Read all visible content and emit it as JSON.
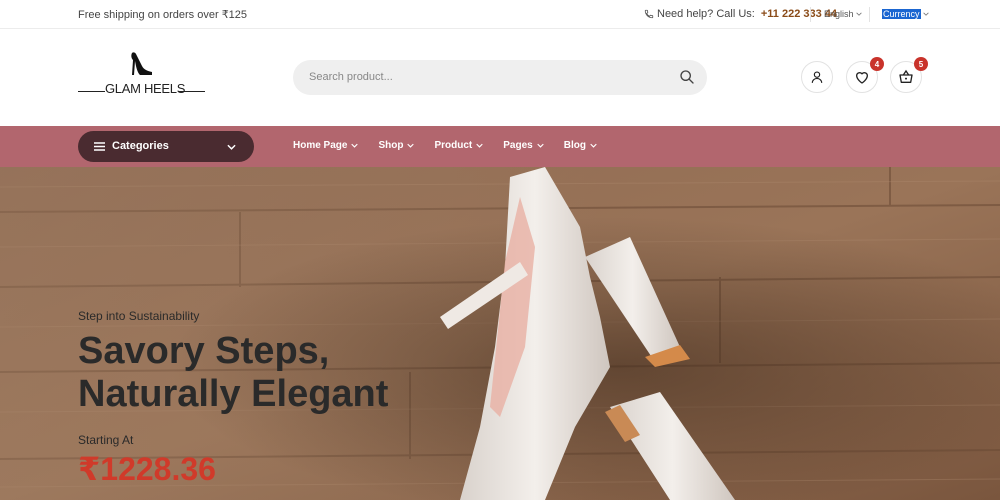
{
  "topbar": {
    "shipping_text": "Free shipping on orders over ₹125",
    "help_text": "Need help? Call Us:",
    "phone": "+11 222 333 44",
    "language": "English",
    "currency": "Currency",
    "phone_icon": "phone-icon",
    "currency_highlight_color": "#1b66d1"
  },
  "header": {
    "logo_text": "GLAM HEELS",
    "search": {
      "placeholder": "Search product..."
    },
    "wishlist_count": "4",
    "cart_count": "5",
    "badge_color": "#c9332b"
  },
  "nav": {
    "categories_label": "Categories",
    "links": [
      {
        "label": "Home Page"
      },
      {
        "label": "Shop"
      },
      {
        "label": "Product"
      },
      {
        "label": "Pages"
      },
      {
        "label": "Blog"
      }
    ],
    "bar_color": "#b2666e",
    "categories_color": "#4a2b30"
  },
  "hero": {
    "kicker": "Step into Sustainability",
    "title_line1": "Savory Steps,",
    "title_line2": "Naturally Elegant",
    "starting_label": "Starting At",
    "price": "₹1228.36",
    "price_color": "#d03a2a"
  }
}
